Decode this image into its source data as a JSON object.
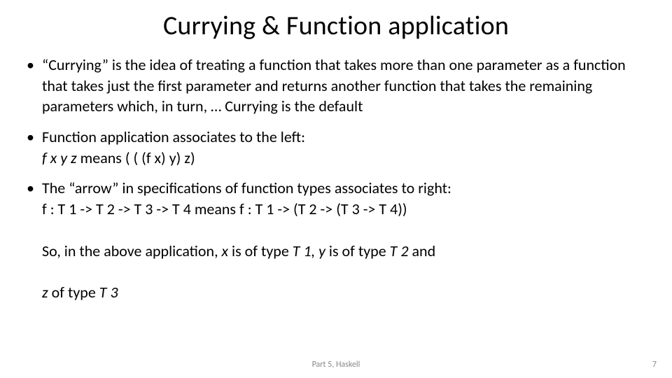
{
  "title": "Currying & Function application",
  "bullets": {
    "b1": "“Currying” is the idea of treating a function that takes more than one parameter as a function that takes just the first parameter and returns another function that takes the remaining parameters which, in turn, … Currying is the default",
    "b2_line1": "Function application associates to the left:",
    "b2_expr_pre": "f  x y z ",
    "b2_means": "means  ",
    "b2_expr_post": "( ( (f  x)  y)  z)",
    "b3_line1": "The “arrow” in specifications of function types associates to right:",
    "b3_line2": "f : T 1 -> T 2 -> T 3  -> T 4 means f : T 1 -> (T 2 -> (T 3 -> T 4))",
    "b3_l3_a": "So, in the above application, ",
    "b3_l3_x": "x",
    "b3_l3_b": " is of type ",
    "b3_l3_T1": "T 1, y ",
    "b3_l3_c": "is of type ",
    "b3_l3_T2": "T 2 ",
    "b3_l3_d": "and",
    "b3_l4_z": "z ",
    "b3_l4_a": "of type ",
    "b3_l4_T3": "T 3"
  },
  "footer": {
    "center": "Part 5, Haskell",
    "page": "7"
  }
}
